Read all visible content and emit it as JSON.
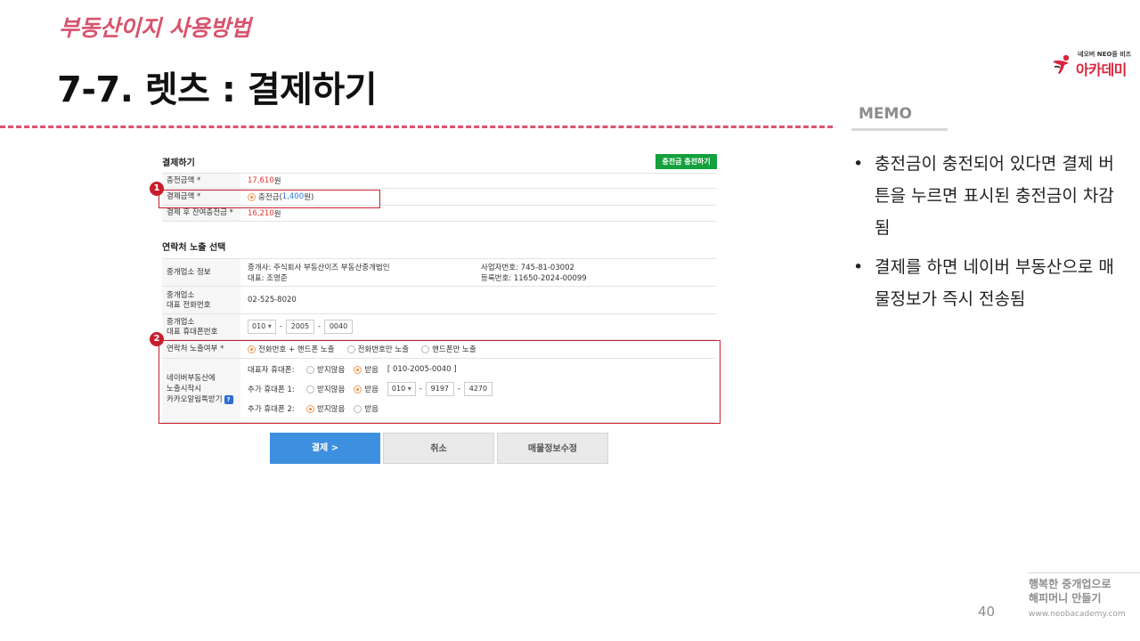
{
  "header": {
    "brand_title": "부동산이지 사용방법",
    "slide_title": "7-7. 렛츠 : 결제하기"
  },
  "logo": {
    "top_line": "네오버 NEO중 비즈",
    "main": "아카데미"
  },
  "memo": {
    "label": "MEMO",
    "items": [
      "충전금이 충전되어 있다면 결제 버튼을 누르면  표시된 충전금이 차감됨",
      "결제를 하면 네이버 부동산으로 매물정보가 즉시 전송됨"
    ]
  },
  "footer": {
    "slogan_line1": "행복한 중개업으로",
    "slogan_line2": "해피머니 만들기",
    "url": "www.neobacademy.com",
    "page_number": "40"
  },
  "screenshot": {
    "payment": {
      "title": "결제하기",
      "charge_button": "충전금 충전하기",
      "rows": [
        {
          "label": "충전금액 *",
          "amount": "17,610",
          "unit": "원"
        },
        {
          "label": "결제금액 *",
          "option": "충전금(",
          "amount": "1,400",
          "unit": "원)"
        },
        {
          "label": "결제 후 잔여충전금 *",
          "amount": "16,210",
          "unit": "원"
        }
      ]
    },
    "contact": {
      "title": "연락처 노출 선택",
      "agency_label": "중개업소 정보",
      "agency_name": "중개사: 주식회사 부동산이즈 부동산중개법인",
      "agency_rep": "대표: 조영준",
      "business_no": "사업자번호: 745-81-03002",
      "registration_no": "등록번호: 11650-2024-00099",
      "phone_label_1": "중개업소",
      "phone_label_2": "대표 전화번호",
      "phone_value": "02-525-8020",
      "mobile_label_1": "중개업소",
      "mobile_label_2": "대표 휴대폰번호",
      "mobile_prefix": "010",
      "mobile_mid": "2005",
      "mobile_last": "0040",
      "exposure_label": "연락처 노출여부 *",
      "exposure_options": [
        "전화번호 + 핸드폰 노출",
        "전화번호만 노출",
        "핸드폰만 노출"
      ],
      "kakao_label_1": "네이버부동산에",
      "kakao_label_2": "노출시작시",
      "kakao_label_3": "카카오알림톡받기",
      "help": "?",
      "rep_mobile_label": "대표자 휴대폰:",
      "extra1_label": "추가 휴대폰 1:",
      "extra2_label": "추가 휴대폰 2:",
      "opt_no": "받지않음",
      "opt_yes": "받음",
      "rep_mobile_value": "[ 010-2005-0040 ]",
      "extra1_prefix": "010",
      "extra1_mid": "9197",
      "extra1_last": "4270",
      "select_arrow": "▾"
    },
    "buttons": {
      "pay": "결제 >",
      "cancel": "취소",
      "edit": "매물정보수정"
    },
    "badges": [
      "1",
      "2"
    ]
  }
}
